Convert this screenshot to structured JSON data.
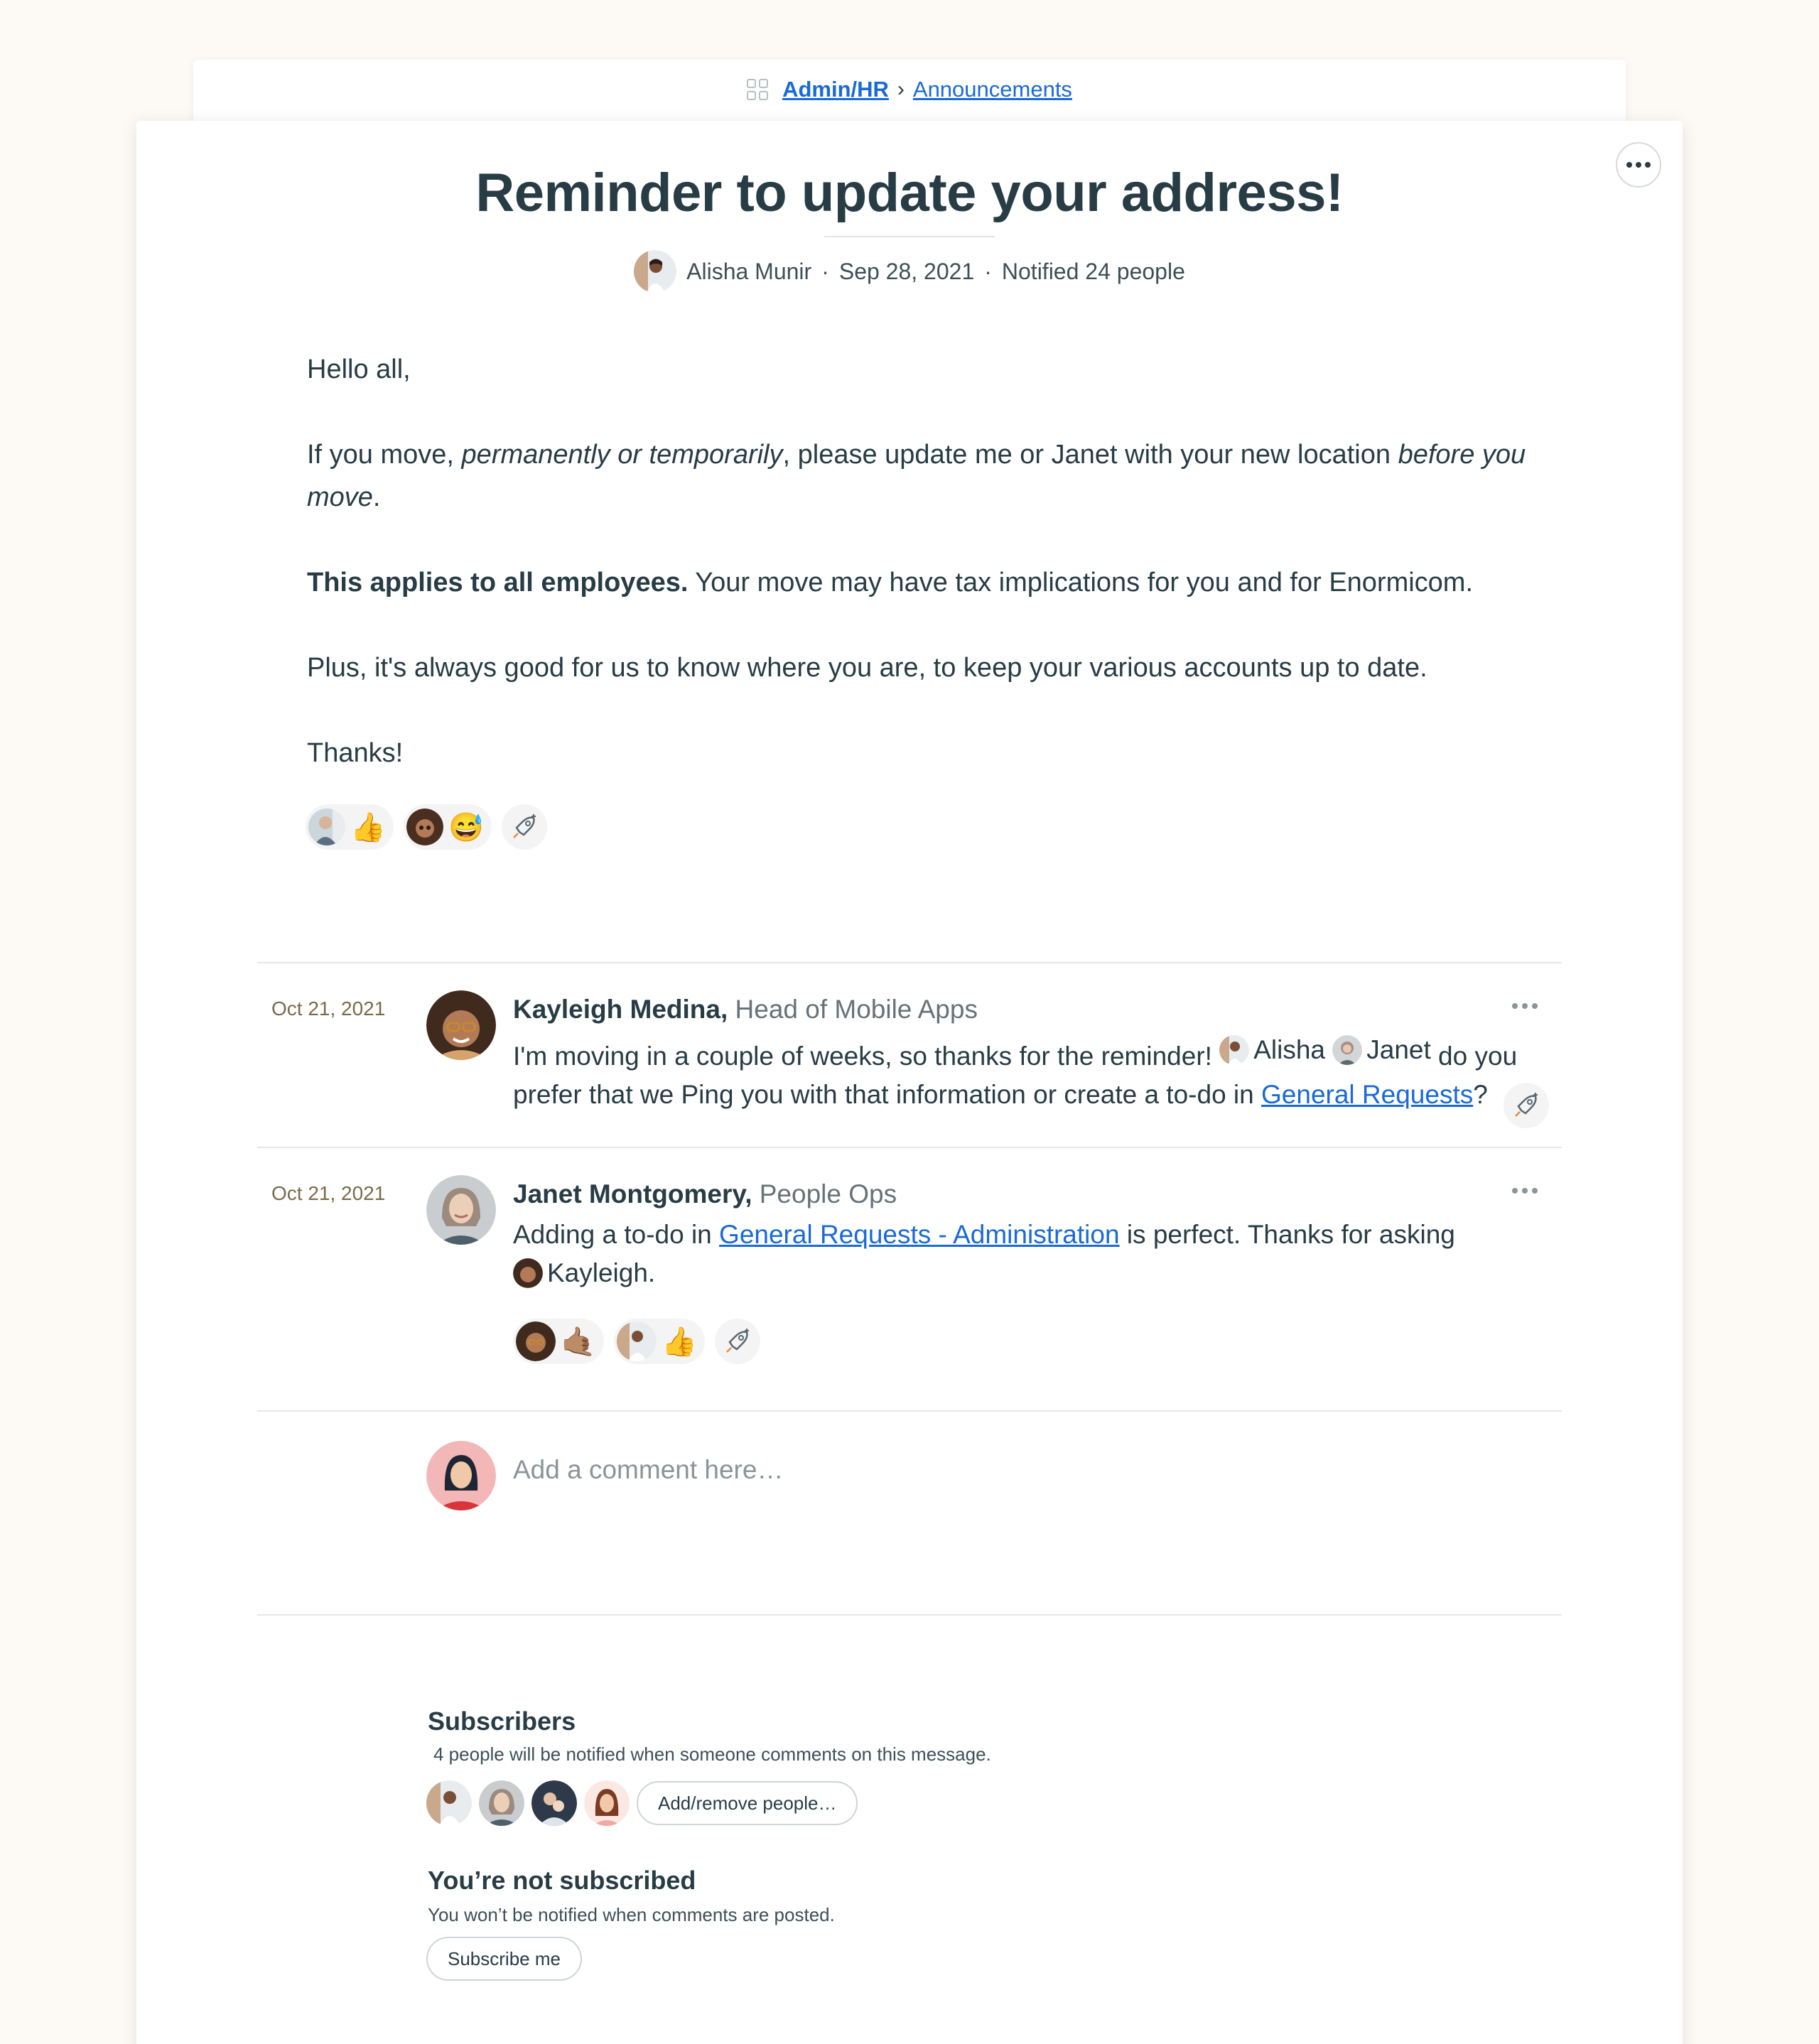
{
  "breadcrumb": {
    "project": "Admin/HR",
    "separator": "›",
    "section": "Announcements"
  },
  "message": {
    "title": "Reminder to update your address!",
    "author": "Alisha Munir",
    "date": "Sep 28, 2021",
    "notified": "Notified 24 people",
    "meta_separator": "·",
    "body": {
      "greeting": "Hello all,",
      "p1_a": "If you move, ",
      "p1_b": "permanently or temporarily",
      "p1_c": ", please update me or Janet with your new location ",
      "p1_d": "before you move",
      "p1_e": ".",
      "p2_bold": "This applies to all employees.",
      "p2_rest": " Your move may have tax implications for you and for Enormicom.",
      "p3": "Plus, it's always good for us to know where you are, to keep your various accounts up to date.",
      "p4": "Thanks!"
    },
    "reactions": [
      {
        "emoji": "👍",
        "icon": "thumbs-up"
      },
      {
        "emoji": "😅",
        "icon": "grinning-sweat"
      }
    ]
  },
  "comments": [
    {
      "date": "Oct 21, 2021",
      "author": "Kayleigh Medina,",
      "role": "Head of Mobile Apps",
      "text_a": "I'm moving in a couple of weeks, so thanks for the reminder! ",
      "mention1": "Alisha",
      "mention2": "Janet",
      "text_b": " do you prefer that we Ping you with that information or create a to-do in ",
      "link": "General Requests",
      "text_c": "?"
    },
    {
      "date": "Oct 21, 2021",
      "author": "Janet Montgomery,",
      "role": "People Ops",
      "text_a": "Adding a to-do in ",
      "link": "General Requests - Administration",
      "text_b": " is perfect. Thanks for asking ",
      "mention": "Kayleigh.",
      "reactions": [
        {
          "emoji": "🤙🏽",
          "icon": "call-me-hand"
        },
        {
          "emoji": "👍",
          "icon": "thumbs-up"
        }
      ]
    }
  ],
  "composer": {
    "placeholder": "Add a comment here…"
  },
  "subscribers": {
    "title": "Subscribers",
    "subtitle": "4 people will be notified when someone comments on this message.",
    "button": "Add/remove people…"
  },
  "subscription": {
    "title": "You’re not subscribed",
    "subtitle": "You won’t be notified when comments are posted.",
    "button": "Subscribe me"
  },
  "colors": {
    "link": "#1a6ad6",
    "text": "#283c46",
    "page_bg": "#fdfaf6",
    "date": "#7c6a4a"
  }
}
